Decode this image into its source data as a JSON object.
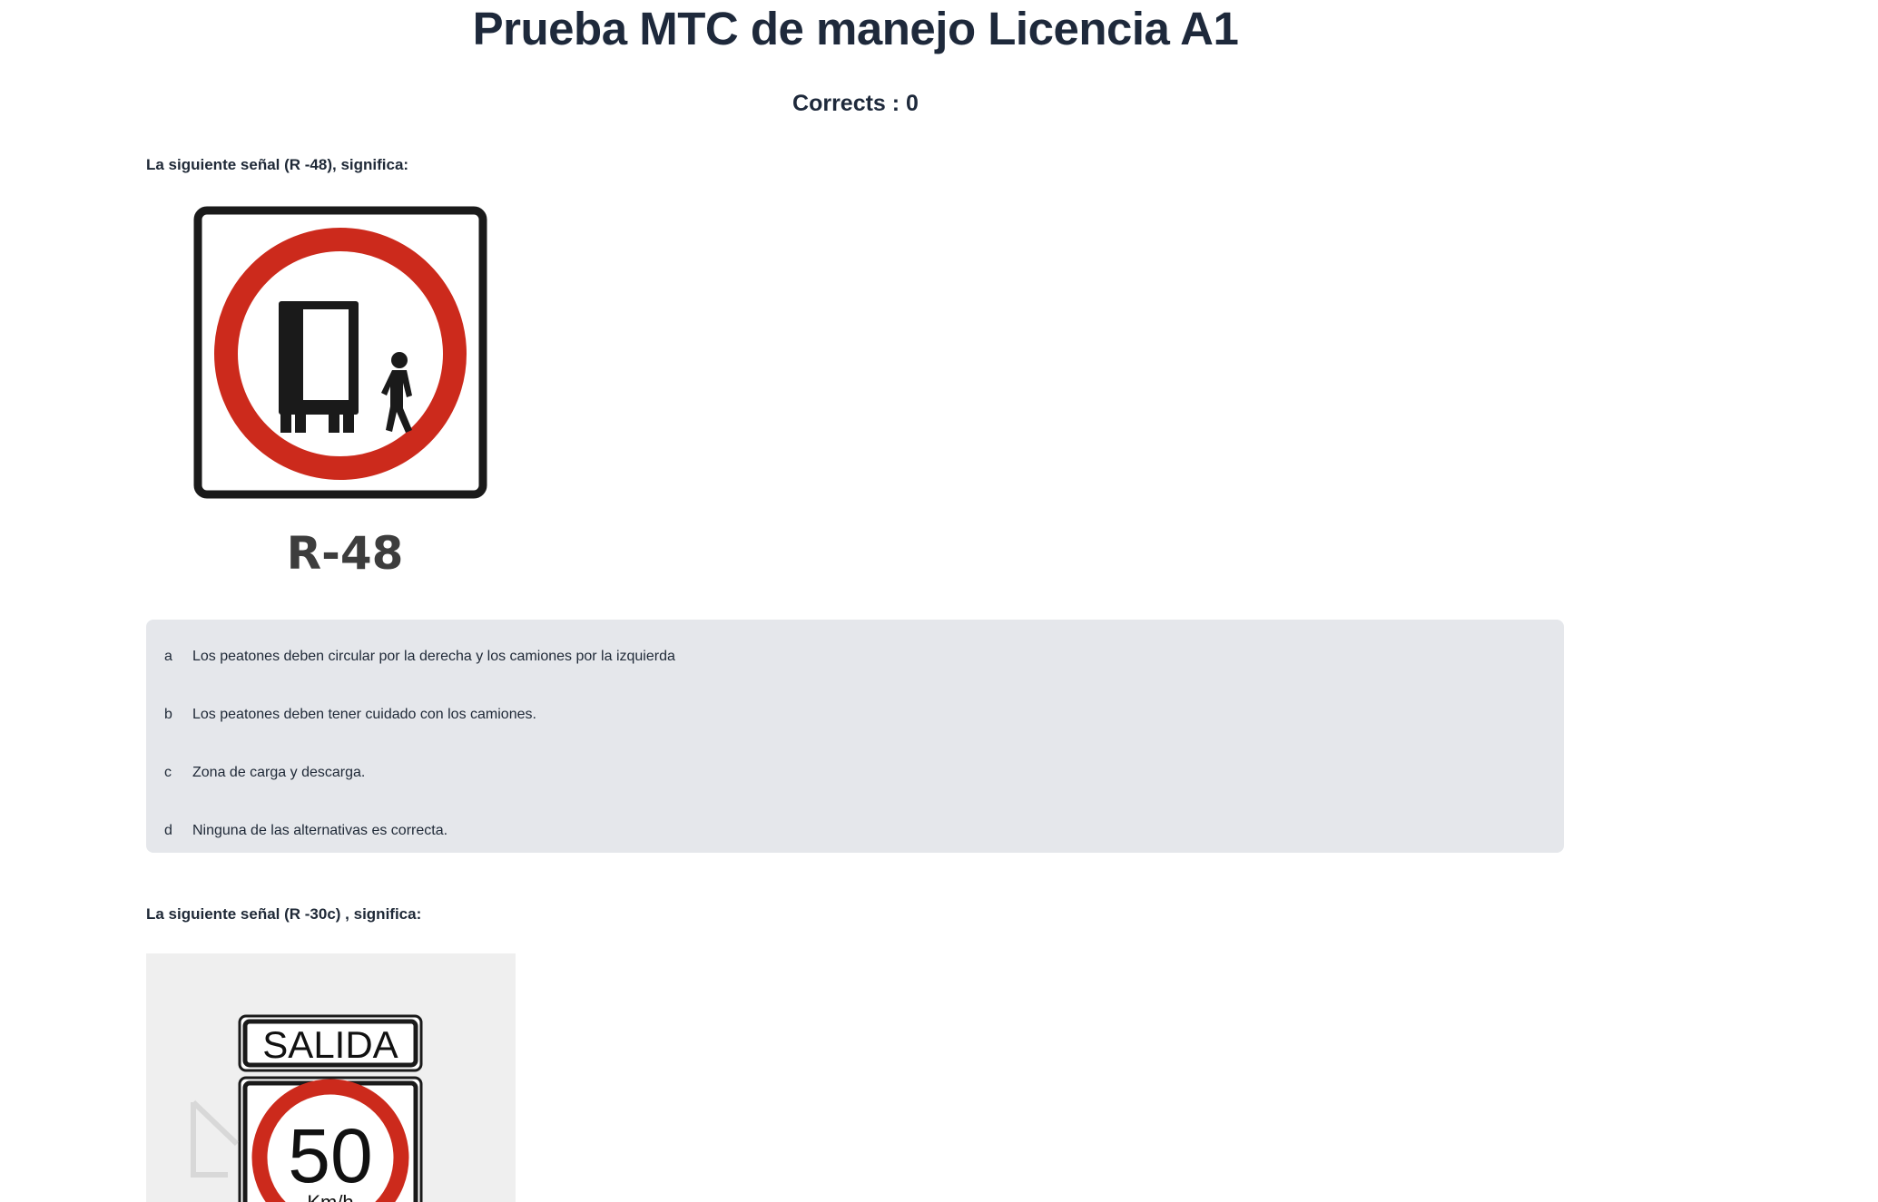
{
  "header": {
    "title": "Prueba MTC de manejo Licencia A1",
    "score_label": "Corrects : 0"
  },
  "questions": [
    {
      "text": "La siguiente señal (R -48), significa:",
      "image": {
        "icon": "road-sign-r48-icon",
        "caption": "R-48",
        "colors": {
          "ring": "#cc2a1c",
          "figure": "#1a1a1a",
          "caption": "#3d3d3d"
        }
      },
      "options": [
        {
          "letter": "a",
          "text": "Los peatones deben  circular por la derecha y los  camiones por la izquierda"
        },
        {
          "letter": "b",
          "text": "Los peatones deben  tener cuidado con los  camiones."
        },
        {
          "letter": "c",
          "text": "Zona de carga y descarga."
        },
        {
          "letter": "d",
          "text": "Ninguna de las alternativas es correcta."
        }
      ]
    },
    {
      "text": "La siguiente señal (R -30c) , significa:",
      "image": {
        "icon": "road-sign-r30c-icon",
        "top_label": "SALIDA",
        "speed_value": "50",
        "speed_unit": "Km/h",
        "colors": {
          "ring": "#cc2a1c",
          "panel_bg": "#efefef"
        }
      }
    }
  ],
  "colors": {
    "title": "#1e293b",
    "options_bg": "#e5e7eb"
  }
}
